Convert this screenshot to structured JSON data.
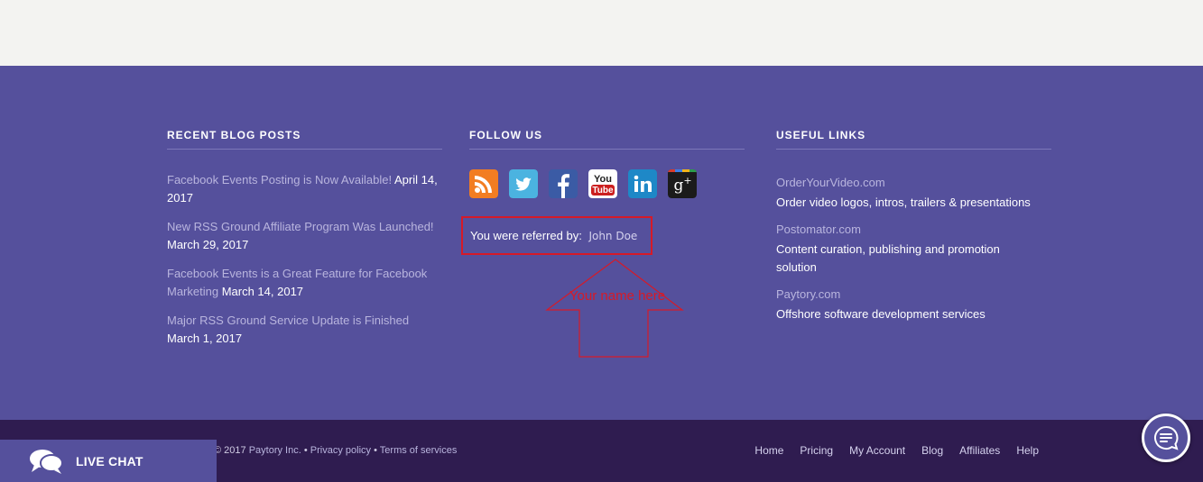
{
  "footer": {
    "recent_posts": {
      "title": "RECENT BLOG POSTS",
      "items": [
        {
          "title": "Facebook Events Posting is Now Available!",
          "date": "April 14, 2017"
        },
        {
          "title": "New RSS Ground Affiliate Program Was Launched!",
          "date": "March 29, 2017"
        },
        {
          "title": "Facebook Events is a Great Feature for Facebook Marketing",
          "date": "March 14, 2017"
        },
        {
          "title": "Major RSS Ground Service Update is Finished",
          "date": "March 1, 2017"
        }
      ]
    },
    "follow_us": {
      "title": "FOLLOW US",
      "icons": [
        "rss-icon",
        "twitter-icon",
        "facebook-icon",
        "youtube-icon",
        "linkedin-icon",
        "google-plus-icon"
      ],
      "referral_label": "You were referred by:",
      "referral_name": "John Doe",
      "annotation": "Your name here"
    },
    "useful_links": {
      "title": "USEFUL LINKS",
      "items": [
        {
          "site": "OrderYourVideo.com",
          "desc": "Order video logos, intros, trailers & presentations"
        },
        {
          "site": "Postomator.com",
          "desc": "Content curation, publishing and promotion solution"
        },
        {
          "site": "Paytory.com",
          "desc": "Offshore software development services"
        }
      ]
    }
  },
  "bottom_bar": {
    "copyright_prefix": "© 2017",
    "company": "Paytory Inc.",
    "separator": "•",
    "privacy": "Privacy policy",
    "terms": "Terms of services",
    "nav": [
      "Home",
      "Pricing",
      "My Account",
      "Blog",
      "Affiliates",
      "Help"
    ]
  },
  "live_chat": {
    "label": "LIVE CHAT"
  },
  "colors": {
    "footer_bg": "#55509c",
    "bottom_bg": "#2f1c50",
    "annotation_red": "#d61a28",
    "link_muted": "#b9b5de"
  }
}
